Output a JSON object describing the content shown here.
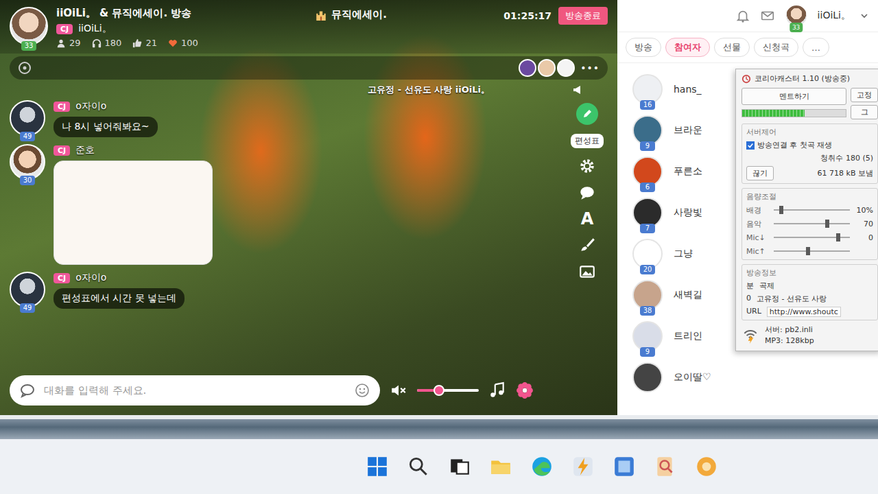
{
  "broadcast": {
    "host": {
      "level": "33",
      "name": "iiOiLi。 & 뮤직에세이. 방송",
      "badge": "CJ",
      "nick": "iiOiLi。"
    },
    "stats": [
      {
        "kind": "fans",
        "value": "29"
      },
      {
        "kind": "listeners",
        "value": "180"
      },
      {
        "kind": "likes",
        "value": "21"
      },
      {
        "kind": "hearts",
        "value": "100"
      }
    ],
    "title": "뮤직에세이.",
    "time": "01:25:17",
    "end_button": "방송종료",
    "now_playing": "고유정 - 선유도 사랑 iiOiLi。",
    "more": "•••"
  },
  "chat": [
    {
      "kind": "text",
      "level": "49",
      "badge": "CJ",
      "name": "o자이o",
      "text": "나 8시 넣어줘봐요~"
    },
    {
      "kind": "sticker",
      "level": "30",
      "badge": "CJ",
      "name": "준호"
    },
    {
      "kind": "text",
      "level": "49",
      "badge": "CJ",
      "name": "o자이o",
      "text": "편성표에서 시간 못 넣는데"
    }
  ],
  "tools": {
    "schedule_label": "편성표",
    "font_glyph": "A"
  },
  "input": {
    "placeholder": "대화를 입력해 주세요.",
    "muted": true,
    "volume_level": 0.35
  },
  "topbar": {
    "level": "33",
    "user": "iiOiLi。"
  },
  "side_tabs": [
    {
      "label": "방송",
      "selected": false
    },
    {
      "label": "참여자",
      "selected": true
    },
    {
      "label": "선물",
      "selected": false
    },
    {
      "label": "신청곡",
      "selected": false
    },
    {
      "label": "…",
      "selected": false
    }
  ],
  "participants": [
    {
      "name": "hans_",
      "level": "16"
    },
    {
      "name": "브라운",
      "level": "9"
    },
    {
      "name": "푸른소",
      "level": "6"
    },
    {
      "name": "사랑빛",
      "level": "7"
    },
    {
      "name": "그냥",
      "level": "20"
    },
    {
      "name": "새벽길",
      "level": "38"
    },
    {
      "name": "트리인",
      "level": "9"
    },
    {
      "name": "오이딸♡"
    }
  ],
  "caster": {
    "title": "코리아캐스터 1.10 (방송중)",
    "ment_button": "멘트하기",
    "side_buttons": [
      "고정",
      "그"
    ],
    "meter_level": 0.6,
    "server_label": "서버제어",
    "autoplay": {
      "label": "방송연결 후 첫곡 재생",
      "checked": true
    },
    "listeners": "청취수 180 (5)",
    "sent": "61 718 kB 보냄",
    "disconnect": "끊기",
    "volume_label": "음량조절",
    "sliders": [
      {
        "label": "배경",
        "level": 0.1,
        "reading": "10%"
      },
      {
        "label": "음악",
        "level": 0.7,
        "reading": "70"
      },
      {
        "label": "Mic↓",
        "level": 0.85,
        "reading": "0"
      },
      {
        "label": "Mic↑",
        "level": 0.45
      }
    ],
    "info_label": "방송정보",
    "info_head": [
      "분",
      "곡제"
    ],
    "info_row": [
      "0",
      "고유정 - 선유도 사랑"
    ],
    "url_label": "URL",
    "url": "http://www.shoutc",
    "server": "서버: pb2.inli",
    "format": "MP3: 128kbp"
  }
}
